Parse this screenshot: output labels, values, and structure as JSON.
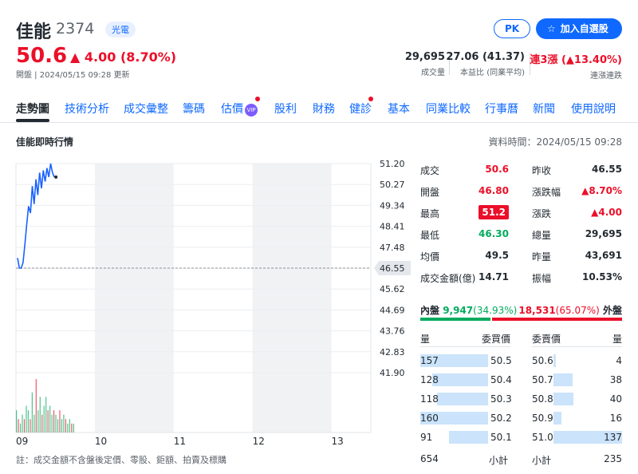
{
  "stock": {
    "name": "佳能",
    "code": "2374",
    "sector": "光電",
    "price": "50.6",
    "change": "4.00 (8.70%)",
    "status": "開盤 | 2024/05/15 09:28 更新"
  },
  "header_buttons": {
    "pk": "PK",
    "watchlist": "加入自選股"
  },
  "header_stats": [
    {
      "value": "29,695",
      "label": "成交量"
    },
    {
      "value": "27.06 (41.37)",
      "label": "本益比 (同業平均)"
    },
    {
      "value": "連3漲 (",
      "value_up": "13.40%)",
      "label": "連漲連跌"
    }
  ],
  "tabs": [
    "走勢圖",
    "技術分析",
    "成交彙整",
    "籌碼",
    "估價",
    "股利",
    "財務",
    "健診",
    "基本",
    "同業比較",
    "行事曆",
    "新聞",
    "使用說明"
  ],
  "vip_label": "VIP",
  "section_title": "佳能即時行情",
  "data_time": "資料時間：2024/05/15 09:28",
  "colors": {
    "up": "#eb0f29",
    "down": "#00ab5e",
    "accent": "#0f69ff",
    "line": "#1a62ff"
  },
  "quote_left": [
    {
      "label": "成交",
      "value": "50.6",
      "color": "up"
    },
    {
      "label": "開盤",
      "value": "46.80",
      "color": "up"
    },
    {
      "label": "最高",
      "value": "51.2",
      "color": "badge"
    },
    {
      "label": "最低",
      "value": "46.30",
      "color": "down"
    },
    {
      "label": "均價",
      "value": "49.5",
      "color": "plain"
    },
    {
      "label": "成交金額(億)",
      "value": "14.71",
      "color": "plain"
    }
  ],
  "quote_right": [
    {
      "label": "昨收",
      "value": "46.55",
      "color": "plain"
    },
    {
      "label": "漲跌幅",
      "value": "▲8.70%",
      "color": "up"
    },
    {
      "label": "漲跌",
      "value": "▲4.00",
      "color": "up"
    },
    {
      "label": "總量",
      "value": "29,695",
      "color": "plain"
    },
    {
      "label": "昨量",
      "value": "43,691",
      "color": "plain"
    },
    {
      "label": "振幅",
      "value": "10.53%",
      "color": "plain"
    }
  ],
  "inner_outer": {
    "inner_label": "內盤",
    "inner_value": "9,947",
    "inner_pct": "(34.93%)",
    "outer_value": "18,531",
    "outer_pct": "(65.07%)",
    "outer_label": "外盤",
    "inner_share": 0.3493
  },
  "orderbook": {
    "headers": {
      "bid_qty": "量",
      "bid_price": "委買價",
      "ask_price": "委賣價",
      "ask_qty": "量"
    },
    "bids": [
      {
        "qty": "157",
        "price": "50.5",
        "share": 1.0
      },
      {
        "qty": "128",
        "price": "50.4",
        "share": 0.82
      },
      {
        "qty": "118",
        "price": "50.3",
        "share": 0.75
      },
      {
        "qty": "160",
        "price": "50.2",
        "share": 1.0
      },
      {
        "qty": "91",
        "price": "50.1",
        "share": 0.58
      }
    ],
    "asks": [
      {
        "price": "50.6",
        "qty": "4",
        "share": 0.03
      },
      {
        "price": "50.7",
        "qty": "38",
        "share": 0.28
      },
      {
        "price": "50.8",
        "qty": "40",
        "share": 0.29
      },
      {
        "price": "50.9",
        "qty": "16",
        "share": 0.12
      },
      {
        "price": "51.0",
        "qty": "137",
        "share": 1.0
      }
    ],
    "bid_total": "654",
    "bid_total_label": "小計",
    "ask_total_label": "小計",
    "ask_total": "235"
  },
  "footnote": "註：成交金額不含盤後定價、零股、鉅額、拍賣及標購",
  "chart_data": {
    "type": "line",
    "x_ticks": [
      "09",
      "10",
      "11",
      "12",
      "13"
    ],
    "y_ticks": [
      "51.20",
      "50.27",
      "49.34",
      "48.41",
      "47.48",
      "46.55",
      "45.62",
      "44.69",
      "43.76",
      "42.83",
      "41.90"
    ],
    "ylim": [
      41.9,
      51.2
    ],
    "reference_price": "46.55",
    "series": [
      {
        "values": [
          47.0,
          46.55,
          46.55,
          46.8,
          47.6,
          48.5,
          49.3,
          49.0,
          50.2,
          49.4,
          50.5,
          49.8,
          50.8,
          50.1,
          50.9,
          50.4,
          51.0,
          50.6,
          51.2,
          50.8,
          50.6
        ]
      }
    ],
    "volume": [
      5,
      3,
      2,
      4,
      3,
      6,
      5,
      3,
      9,
      4,
      12,
      5,
      8,
      4,
      6,
      8,
      5,
      6,
      4,
      5,
      4,
      3,
      5,
      3,
      4,
      3,
      2,
      3,
      2,
      2
    ]
  }
}
